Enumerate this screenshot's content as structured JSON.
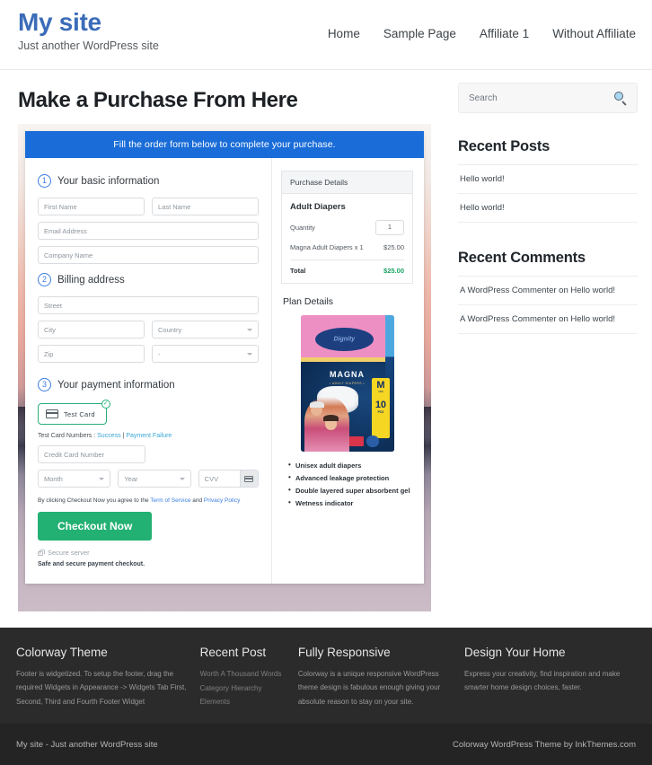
{
  "header": {
    "site_title": "My site",
    "tagline": "Just another WordPress site",
    "nav": [
      {
        "label": "Home"
      },
      {
        "label": "Sample Page"
      },
      {
        "label": "Affiliate 1"
      },
      {
        "label": "Without Affiliate"
      }
    ]
  },
  "main": {
    "page_title": "Make a Purchase From Here",
    "form": {
      "banner": "Fill the order form below to complete your purchase.",
      "step1": {
        "num": "1",
        "label": "Your basic information"
      },
      "step2": {
        "num": "2",
        "label": "Billing address"
      },
      "step3": {
        "num": "3",
        "label": "Your payment information"
      },
      "fields": {
        "first_name": "First Name",
        "last_name": "Last Name",
        "email": "Email Address",
        "company": "Company Name",
        "street": "Street",
        "city": "City",
        "country": "Country",
        "zip": "Zip",
        "state": "-",
        "credit_card": "Credit Card Number",
        "month": "Month",
        "year": "Year",
        "cvv": "CVV"
      },
      "test_card_button": "Test Card",
      "test_card_numbers_label": "Test Card Numbers :",
      "test_card_success": "Success",
      "test_card_separator": "|",
      "test_card_failure": "Payment Failure",
      "terms_prefix": "By clicking Checkout Now you agree to the",
      "terms_link1": "Term of Service",
      "terms_and": "and",
      "terms_link2": "Privacy Policy",
      "checkout_button": "Checkout Now",
      "secure_server": "Secure server",
      "safe_note": "Safe and secure payment checkout."
    },
    "purchase_details": {
      "heading": "Purchase Details",
      "product": "Adult Diapers",
      "quantity_label": "Quantity",
      "quantity_value": "1",
      "line_item_label": "Magna Adult Diapers x 1",
      "line_item_price": "$25.00",
      "total_label": "Total",
      "total_value": "$25.00"
    },
    "plan": {
      "title": "Plan Details",
      "product_image": {
        "brand": "Dignity",
        "name": "MAGNA",
        "subtitle": "• ADULT DIAPERS •",
        "size": "M",
        "size_caption": "SIZE",
        "count": "10",
        "count_caption": "PCS"
      },
      "features": [
        "Unisex adult diapers",
        "Advanced leakage protection",
        "Double layered super absorbent gel",
        "Wetness indicator"
      ]
    }
  },
  "sidebar": {
    "search_placeholder": "Search",
    "recent_posts_title": "Recent Posts",
    "recent_posts": [
      {
        "label": "Hello world!"
      },
      {
        "label": "Hello world!"
      }
    ],
    "recent_comments_title": "Recent Comments",
    "recent_comments": [
      {
        "label": "A WordPress Commenter on Hello world!"
      },
      {
        "label": "A WordPress Commenter on Hello world!"
      }
    ]
  },
  "footer": {
    "columns": [
      {
        "title": "Colorway Theme",
        "text": "Footer is widgetized. To setup the footer, drag the required Widgets in Appearance -> Widgets Tab First, Second, Third and Fourth Footer Widget"
      },
      {
        "title": "Recent Post",
        "items": [
          {
            "label": "Worth A Thousand Words"
          },
          {
            "label": "Category Hierarchy"
          },
          {
            "label": "Elements"
          }
        ]
      },
      {
        "title": "Fully Responsive",
        "text": "Colorway is a unique responsive WordPress theme design is fabulous enough giving your absolute reason to stay on your site."
      },
      {
        "title": "Design Your Home",
        "text": "Express your creativity, find inspiration and make smarter home design choices, faster."
      }
    ],
    "copyright_left": "My site - Just another WordPress site",
    "copyright_right": "Colorway WordPress Theme by InkThemes.com"
  },
  "colors": {
    "brand_blue": "#3b6cb8",
    "banner_blue": "#1a6dd8",
    "checkout_green": "#23b173",
    "total_green": "#19a463",
    "footer_dark": "#2b2b2b"
  }
}
